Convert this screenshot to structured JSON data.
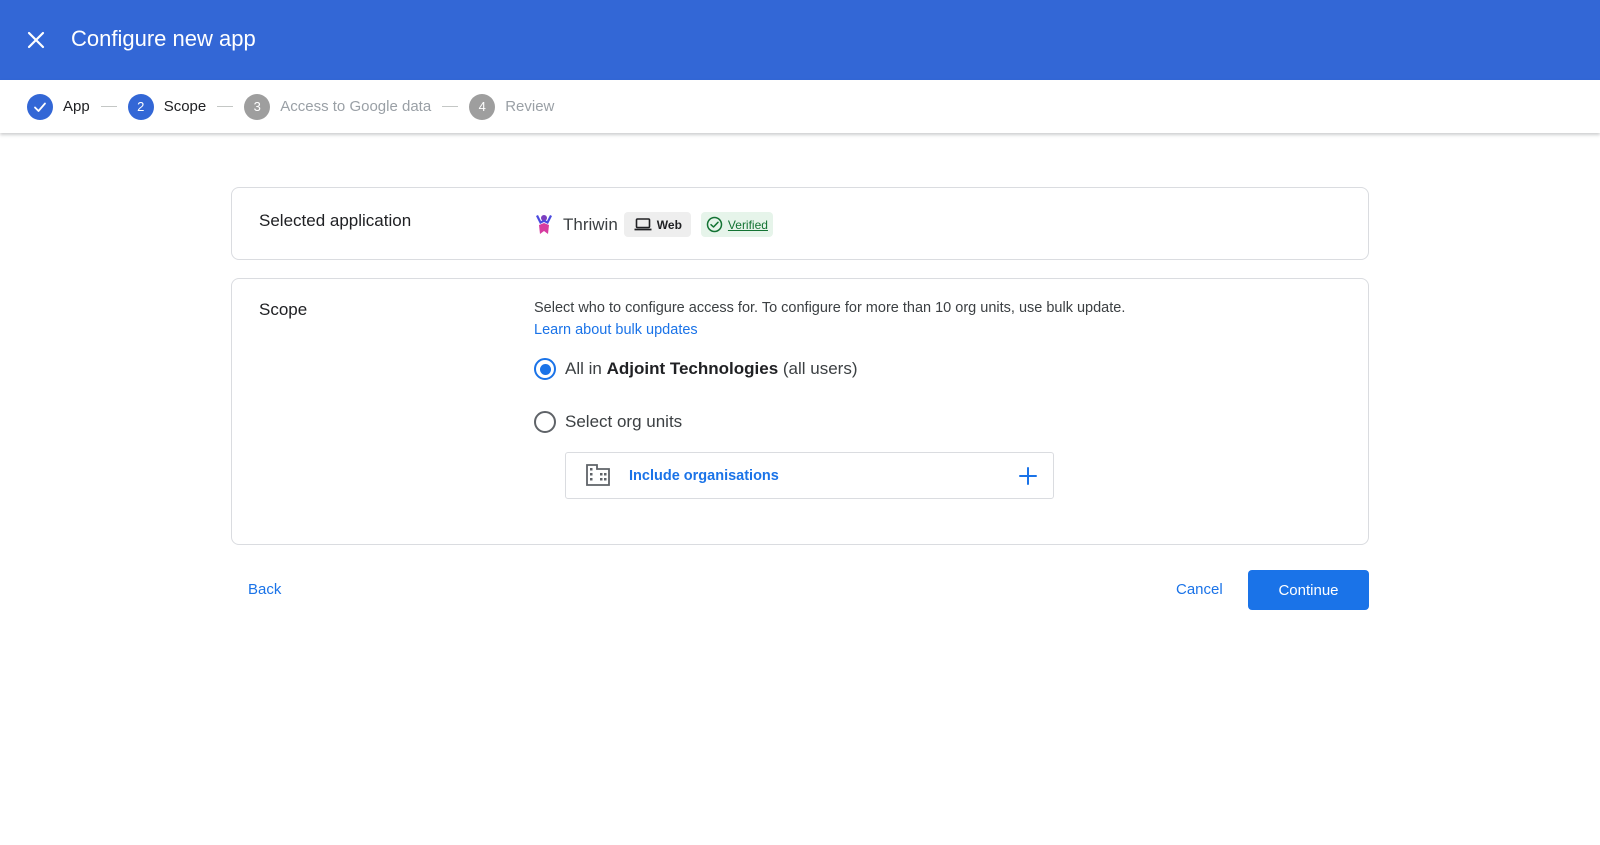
{
  "appbar": {
    "title": "Configure new app",
    "close_icon": "close-icon"
  },
  "stepper": {
    "steps": [
      {
        "number": "1",
        "label": "App",
        "state": "completed"
      },
      {
        "number": "2",
        "label": "Scope",
        "state": "current"
      },
      {
        "number": "3",
        "label": "Access to Google data",
        "state": "upcoming"
      },
      {
        "number": "4",
        "label": "Review",
        "state": "upcoming"
      }
    ]
  },
  "selected_app": {
    "label": "Selected application",
    "name": "Thriwin",
    "platform_chip": "Web",
    "verified_chip": "Verified"
  },
  "scope": {
    "label": "Scope",
    "description": "Select who to configure access for. To configure for more than 10 org units, use bulk update.",
    "learn_link": "Learn about bulk updates",
    "option_all": {
      "prefix": "All in ",
      "org_name": "Adjoint Technologies",
      "suffix": " (all users)",
      "checked": true
    },
    "option_select": {
      "label": "Select org units",
      "checked": false
    },
    "include_orgs": "Include organisations"
  },
  "footer": {
    "back": "Back",
    "cancel": "Cancel",
    "continue": "Continue"
  },
  "colors": {
    "appbar": "#3367d6",
    "primary": "#1a73e8",
    "verified_bg": "#e6f4ea",
    "verified_text": "#137333"
  }
}
